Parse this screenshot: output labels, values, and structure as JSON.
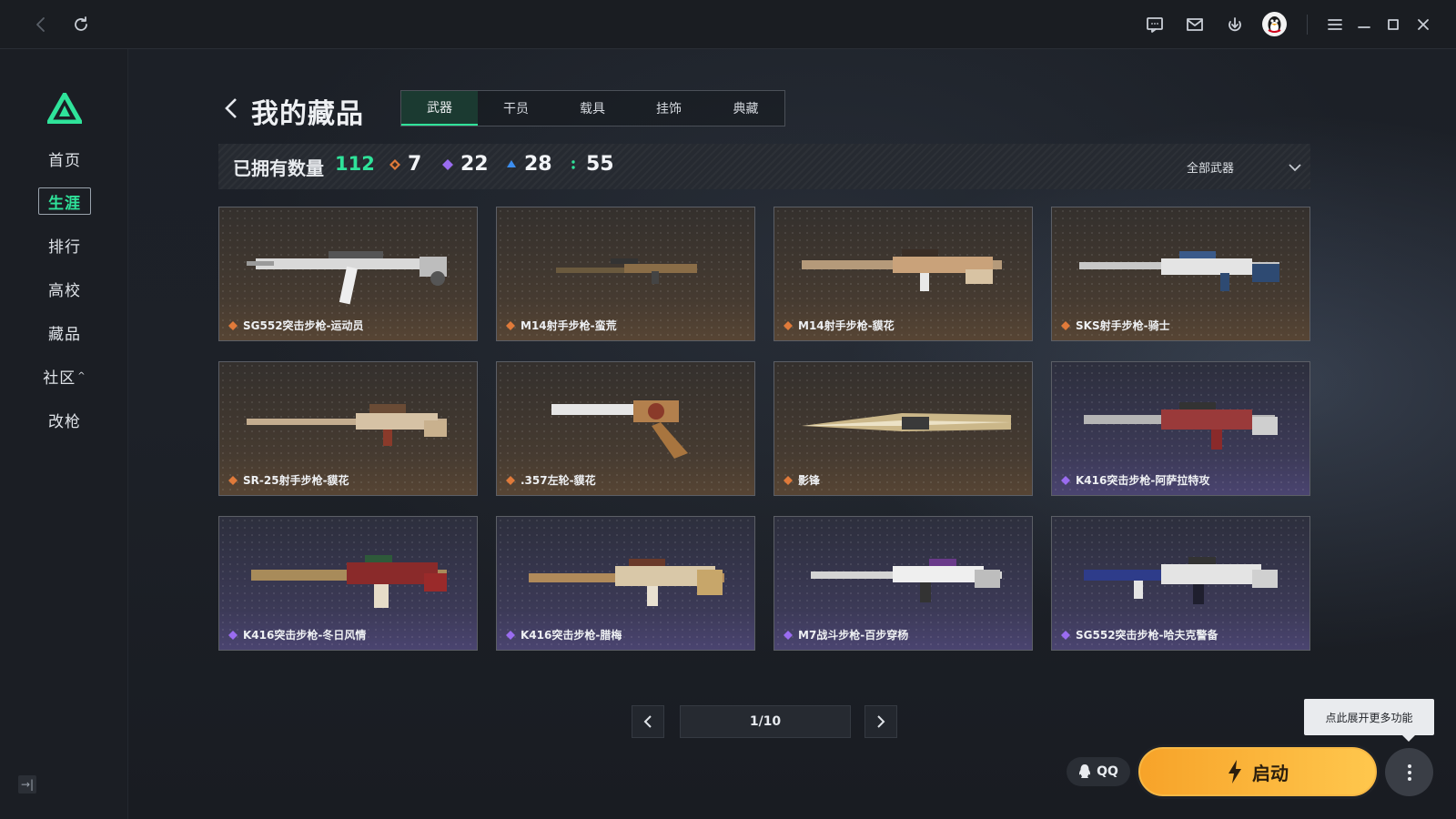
{
  "titlebar": {
    "left_buttons": [
      {
        "name": "back-nav-button",
        "icon": "chevron-left-icon"
      },
      {
        "name": "refresh-button",
        "icon": "refresh-icon"
      }
    ],
    "right_buttons": [
      {
        "name": "chat-button",
        "icon": "chat-bubble-icon"
      },
      {
        "name": "mail-button",
        "icon": "mail-icon"
      },
      {
        "name": "download-button",
        "icon": "download-icon"
      },
      {
        "name": "menu-button",
        "icon": "hamburger-menu-icon"
      },
      {
        "name": "minimize-button",
        "icon": "minimize-icon"
      },
      {
        "name": "maximize-button",
        "icon": "maximize-icon"
      },
      {
        "name": "close-button",
        "icon": "close-icon"
      }
    ]
  },
  "sidebar": {
    "logo_icon": "triangle-logo-icon",
    "items": [
      {
        "label": "首页",
        "active": false
      },
      {
        "label": "生涯",
        "active": true
      },
      {
        "label": "排行",
        "active": false
      },
      {
        "label": "高校",
        "active": false
      },
      {
        "label": "藏品",
        "active": false
      },
      {
        "label": "社区",
        "active": false,
        "caret": "^"
      },
      {
        "label": "改枪",
        "active": false
      }
    ],
    "collapse_icon": "→|"
  },
  "header": {
    "title": "我的藏品",
    "tabs": [
      {
        "label": "武器",
        "active": true
      },
      {
        "label": "干员",
        "active": false
      },
      {
        "label": "载具",
        "active": false
      },
      {
        "label": "挂饰",
        "active": false
      },
      {
        "label": "典藏",
        "active": false
      }
    ]
  },
  "stats": {
    "owned_label": "已拥有数量",
    "owned_total": "112",
    "tiers": [
      {
        "value": "7",
        "color": "#e07a3a",
        "icon": "orange-diamond-icon"
      },
      {
        "value": "22",
        "color": "#9a6cf0",
        "icon": "purple-diamond-icon"
      },
      {
        "value": "28",
        "color": "#3c8ef0",
        "icon": "blue-diamond-icon"
      },
      {
        "value": "55",
        "color": "#2fe39a",
        "icon": "green-dots-icon"
      }
    ],
    "filter_label": "全部武器"
  },
  "items": [
    {
      "name": "SG552突击步枪-运动员",
      "rarity": "gold"
    },
    {
      "name": "M14射手步枪-蛮荒",
      "rarity": "gold"
    },
    {
      "name": "M14射手步枪-貘花",
      "rarity": "gold"
    },
    {
      "name": "SKS射手步枪-骑士",
      "rarity": "gold"
    },
    {
      "name": "SR-25射手步枪-貘花",
      "rarity": "gold"
    },
    {
      "name": ".357左轮-貘花",
      "rarity": "gold"
    },
    {
      "name": "影锋",
      "rarity": "gold"
    },
    {
      "name": "K416突击步枪-阿萨拉特攻",
      "rarity": "purple"
    },
    {
      "name": "K416突击步枪-冬日风情",
      "rarity": "purple"
    },
    {
      "name": "K416突击步枪-腊梅",
      "rarity": "purple"
    },
    {
      "name": "M7战斗步枪-百步穿杨",
      "rarity": "purple"
    },
    {
      "name": "SG552突击步枪-哈夫克警备",
      "rarity": "purple"
    }
  ],
  "pagination": {
    "indicator": "1/10"
  },
  "bottom": {
    "tooltip": "点此展开更多功能",
    "qq_label": "QQ",
    "launch_label": "启动",
    "accent": "#2fe39a",
    "launch_color": "#f7a329"
  }
}
